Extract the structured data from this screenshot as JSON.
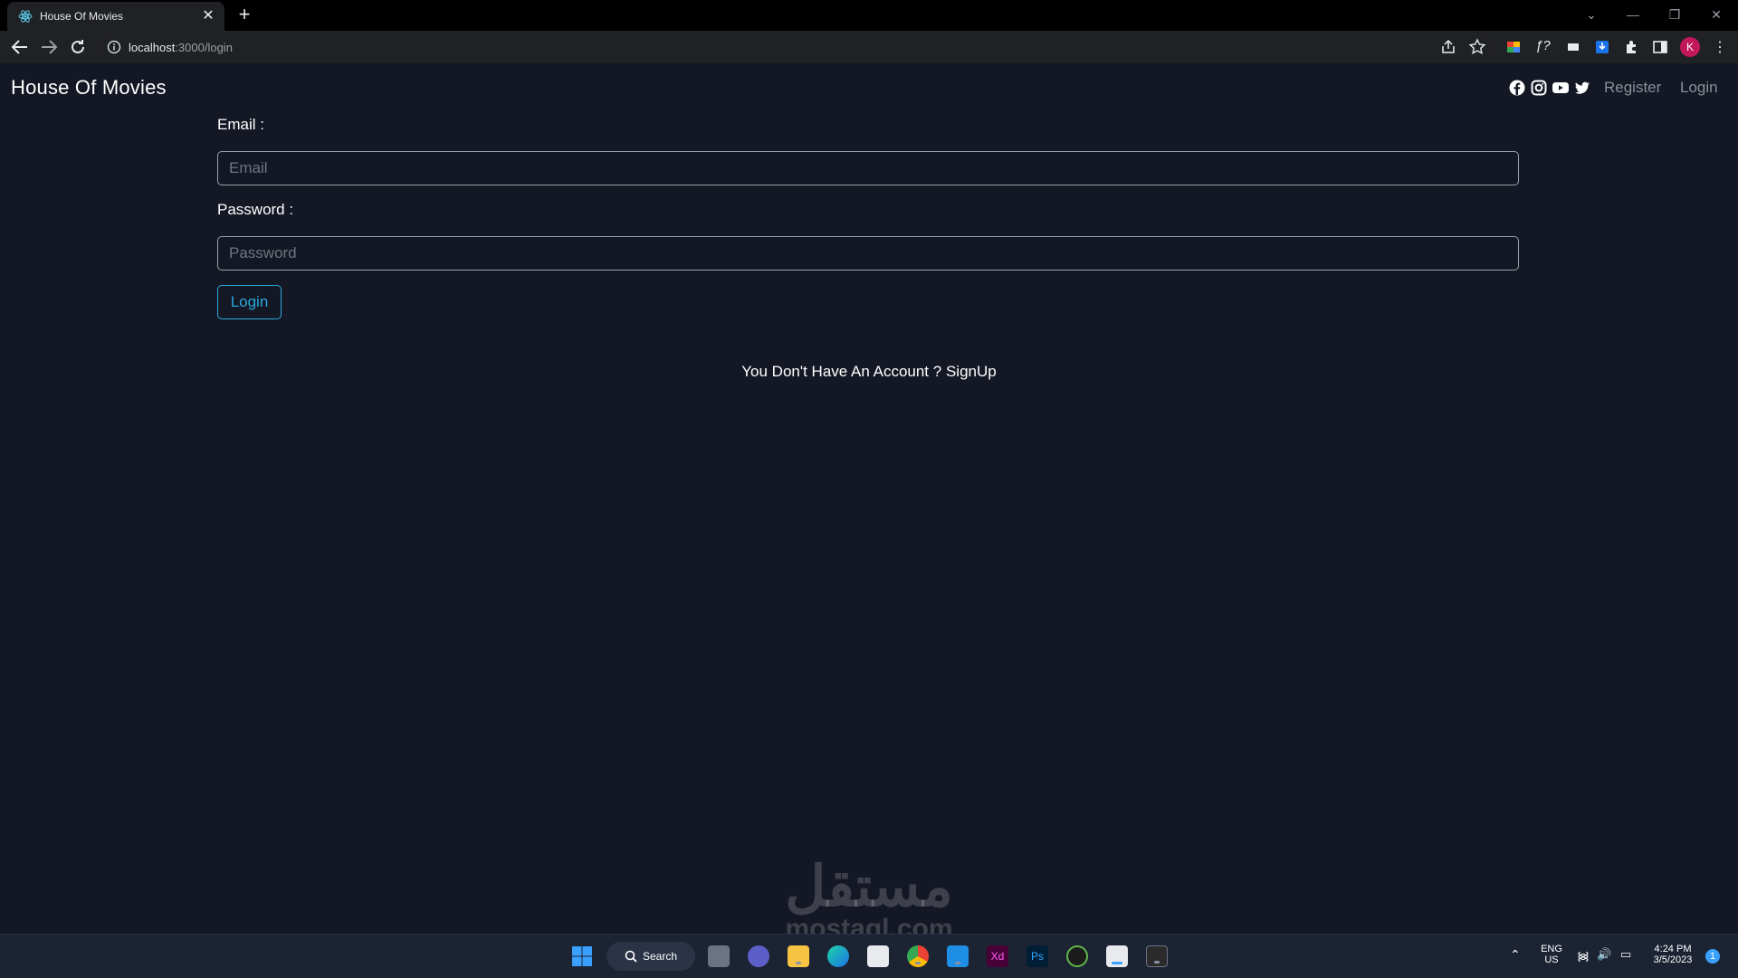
{
  "browser": {
    "tab_title": "House Of Movies",
    "url_host": "localhost",
    "url_rest": ":3000/login",
    "avatar_letter": "K"
  },
  "page": {
    "brand": "House Of Movies",
    "nav": {
      "register": "Register",
      "login": "Login"
    },
    "social_icons": [
      "facebook-icon",
      "instagram-icon",
      "youtube-icon",
      "twitter-icon"
    ],
    "form": {
      "email_label": "Email :",
      "email_placeholder": "Email",
      "email_value": "",
      "password_label": "Password :",
      "password_placeholder": "Password",
      "password_value": "",
      "submit_label": "Login"
    },
    "signup_prompt": "You Don't Have An Account ?",
    "signup_link": "SignUp",
    "colors": {
      "background": "#141824",
      "accent": "#2aa8e0",
      "muted": "#8a8f98"
    }
  },
  "watermark": {
    "arabic": "مستقل",
    "latin": "mostaql.com"
  },
  "taskbar": {
    "search_label": "Search",
    "lang_top": "ENG",
    "lang_bottom": "US",
    "time": "4:24 PM",
    "date": "3/5/2023",
    "notification_count": "1"
  }
}
